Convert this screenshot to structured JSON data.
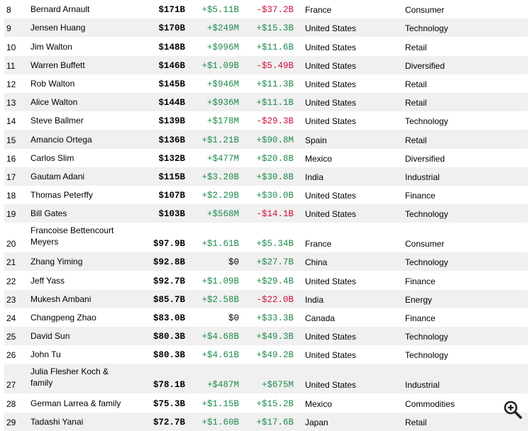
{
  "rows": [
    {
      "rank": "8",
      "name": "Bernard Arnault",
      "worth": "$171B",
      "day": "+$5.11B",
      "ytd": "-$37.2B",
      "country": "France",
      "industry": "Consumer"
    },
    {
      "rank": "9",
      "name": "Jensen Huang",
      "worth": "$170B",
      "day": "+$249M",
      "ytd": "+$15.3B",
      "country": "United States",
      "industry": "Technology"
    },
    {
      "rank": "10",
      "name": "Jim Walton",
      "worth": "$148B",
      "day": "+$996M",
      "ytd": "+$11.6B",
      "country": "United States",
      "industry": "Retail"
    },
    {
      "rank": "11",
      "name": "Warren Buffett",
      "worth": "$146B",
      "day": "+$1.09B",
      "ytd": "-$5.49B",
      "country": "United States",
      "industry": "Diversified"
    },
    {
      "rank": "12",
      "name": "Rob Walton",
      "worth": "$145B",
      "day": "+$946M",
      "ytd": "+$11.3B",
      "country": "United States",
      "industry": "Retail"
    },
    {
      "rank": "13",
      "name": "Alice Walton",
      "worth": "$144B",
      "day": "+$936M",
      "ytd": "+$11.1B",
      "country": "United States",
      "industry": "Retail"
    },
    {
      "rank": "14",
      "name": "Steve Ballmer",
      "worth": "$139B",
      "day": "+$178M",
      "ytd": "-$29.3B",
      "country": "United States",
      "industry": "Technology"
    },
    {
      "rank": "15",
      "name": "Amancio Ortega",
      "worth": "$136B",
      "day": "+$1.21B",
      "ytd": "+$90.8M",
      "country": "Spain",
      "industry": "Retail"
    },
    {
      "rank": "16",
      "name": "Carlos Slim",
      "worth": "$132B",
      "day": "+$477M",
      "ytd": "+$20.8B",
      "country": "Mexico",
      "industry": "Diversified"
    },
    {
      "rank": "17",
      "name": "Gautam Adani",
      "worth": "$115B",
      "day": "+$3.20B",
      "ytd": "+$30.8B",
      "country": "India",
      "industry": "Industrial"
    },
    {
      "rank": "18",
      "name": "Thomas Peterffy",
      "worth": "$107B",
      "day": "+$2.29B",
      "ytd": "+$30.0B",
      "country": "United States",
      "industry": "Finance"
    },
    {
      "rank": "19",
      "name": "Bill Gates",
      "worth": "$103B",
      "day": "+$568M",
      "ytd": "-$14.1B",
      "country": "United States",
      "industry": "Technology"
    },
    {
      "rank": "20",
      "name": "Francoise Bettencourt Meyers",
      "worth": "$97.9B",
      "day": "+$1.61B",
      "ytd": "+$5.34B",
      "country": "France",
      "industry": "Consumer"
    },
    {
      "rank": "21",
      "name": "Zhang Yiming",
      "worth": "$92.8B",
      "day": "$0",
      "ytd": "+$27.7B",
      "country": "China",
      "industry": "Technology"
    },
    {
      "rank": "22",
      "name": "Jeff Yass",
      "worth": "$92.7B",
      "day": "+$1.09B",
      "ytd": "+$29.4B",
      "country": "United States",
      "industry": "Finance"
    },
    {
      "rank": "23",
      "name": "Mukesh Ambani",
      "worth": "$85.7B",
      "day": "+$2.58B",
      "ytd": "-$22.0B",
      "country": "India",
      "industry": "Energy"
    },
    {
      "rank": "24",
      "name": "Changpeng Zhao",
      "worth": "$83.0B",
      "day": "$0",
      "ytd": "+$33.3B",
      "country": "Canada",
      "industry": "Finance"
    },
    {
      "rank": "25",
      "name": "David Sun",
      "worth": "$80.3B",
      "day": "+$4.68B",
      "ytd": "+$49.3B",
      "country": "United States",
      "industry": "Technology"
    },
    {
      "rank": "26",
      "name": "John Tu",
      "worth": "$80.3B",
      "day": "+$4.61B",
      "ytd": "+$49.2B",
      "country": "United States",
      "industry": "Technology"
    },
    {
      "rank": "27",
      "name": "Julia Flesher Koch & family",
      "worth": "$78.1B",
      "day": "+$487M",
      "ytd": "+$675M",
      "country": "United States",
      "industry": "Industrial"
    },
    {
      "rank": "28",
      "name": "German Larrea & family",
      "worth": "$75.3B",
      "day": "+$1.15B",
      "ytd": "+$15.2B",
      "country": "Mexico",
      "industry": "Commodities"
    },
    {
      "rank": "29",
      "name": "Tadashi Yanai",
      "worth": "$72.7B",
      "day": "+$1.60B",
      "ytd": "+$17.6B",
      "country": "Japan",
      "industry": "Retail"
    }
  ],
  "colors": {
    "positive": "#1f8a4c",
    "negative": "#d0103a",
    "row_alt": "#f0f0f0"
  },
  "zoom_button": {
    "icon": "zoom-in-icon"
  }
}
